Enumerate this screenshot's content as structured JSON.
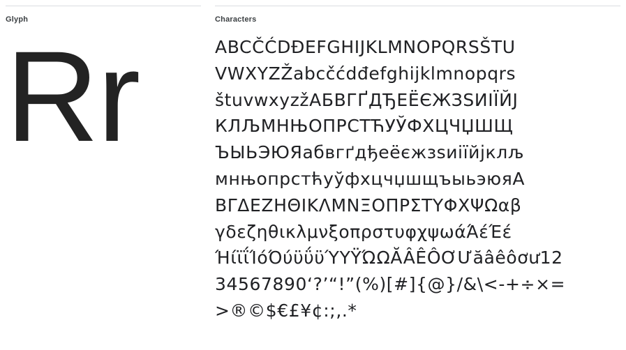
{
  "panels": {
    "glyph": {
      "label": "Glyph",
      "sample": "Rr"
    },
    "characters": {
      "label": "Characters",
      "rows": [
        "ABCČĆDĐEFGHIJKLMNOPQRSŠTU",
        "VWXYZŽabcčćdđefghijklmnopqrs",
        "štuvwxyzžАБВГҐДЂЕЁЄЖЗЅИІЇЙJ",
        "КЛЉМНЊОПРСТЋУЎФХЦЧЏШЩ",
        "ЪЫЬЭЮЯабвгґдђеёєжзѕиіїйјклљ",
        "мнњопрстћуўфхцчџшщъыьэюяА",
        "ΒΓΔΕΖΗΘΙΚΛΜΝΞΟΠΡΣΤΥΦΧΨΩαβ",
        "γδεζηθικλμνξοπρστυφχψωάΆέΈέ",
        "ΉίϊΐΊόΌύϋΰϋΎΥΫΏΩĂÂÊÔƠƯăâêôơư12",
        "34567890‘?’“!”(%)[#]{@}/&\\<-+÷×=",
        ">®©$€£¥¢:;,.*"
      ]
    }
  }
}
